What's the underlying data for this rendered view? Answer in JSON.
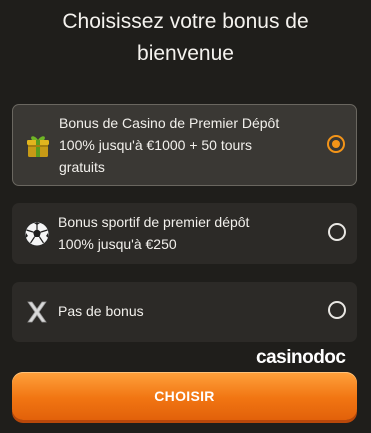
{
  "header": {
    "title_line1": "Choisissez votre bonus de",
    "title_line2": "bienvenue"
  },
  "options": [
    {
      "label_line1": "Bonus de Casino de Premier Dépôt",
      "label_line2": "100% jusqu'à €1000 + 50 tours",
      "label_line3": "gratuits",
      "icon": "gift-icon",
      "selected": true
    },
    {
      "label_line1": "Bonus sportif de premier dépôt",
      "label_line2": "100% jusqu'à €250",
      "icon": "soccer-ball-icon",
      "selected": false
    },
    {
      "label_line1": "Pas de bonus",
      "icon": "no-bonus-x-icon",
      "selected": false
    }
  ],
  "brand": {
    "watermark": "casinodoc"
  },
  "actions": {
    "choose_label": "CHOISIR"
  },
  "colors": {
    "accent": "#f39418",
    "background": "#1f1e1b",
    "card": "#2c2a27",
    "card_selected": "#3a3834"
  }
}
